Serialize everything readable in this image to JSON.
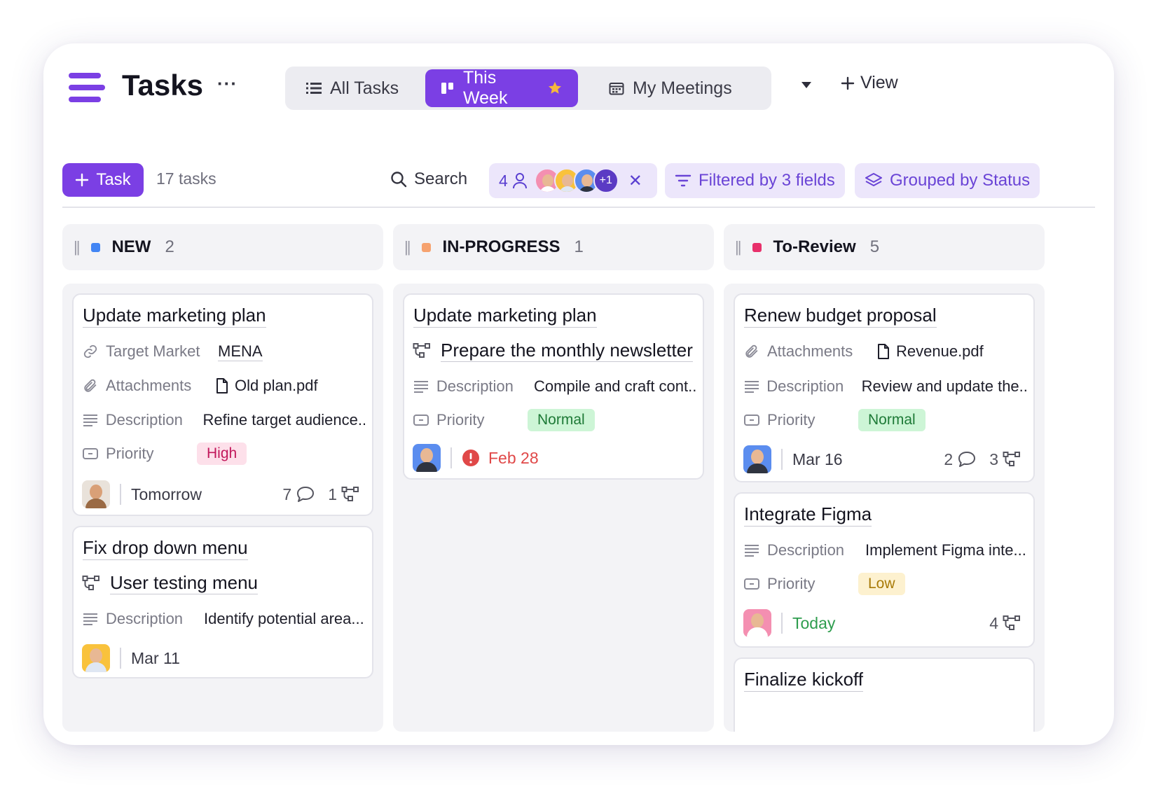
{
  "header": {
    "title": "Tasks",
    "more_label": "···",
    "views": [
      {
        "label": "All Tasks",
        "icon": "list-icon"
      },
      {
        "label": "This Week",
        "icon": "board-icon",
        "starred": true
      },
      {
        "label": "My Meetings",
        "icon": "calendar-icon"
      }
    ],
    "add_view_label": "View"
  },
  "toolbar": {
    "add_task_label": "Task",
    "task_count": "17 tasks",
    "search_label": "Search",
    "people_count": "4",
    "people_extra": "+1",
    "filter_label": "Filtered by 3 fields",
    "group_label": "Grouped by Status"
  },
  "colors": {
    "accent": "#7b3fe4",
    "new": "#4285f4",
    "in_progress": "#f6a26f",
    "to_review": "#e8306b"
  },
  "columns": [
    {
      "name": "NEW",
      "count": "2",
      "cards": [
        {
          "title": "Update marketing plan",
          "fields": [
            {
              "icon": "link-icon",
              "label": "Target Market",
              "value": "MENA"
            },
            {
              "icon": "paperclip-icon",
              "label": "Attachments",
              "value": "Old plan.pdf"
            },
            {
              "icon": "description-icon",
              "label": "Description",
              "value": "Refine target audience.."
            },
            {
              "icon": "priority-icon",
              "label": "Priority",
              "value": "High"
            }
          ],
          "footer": {
            "date": "Tomorrow",
            "comments": "7",
            "subtasks": "1"
          }
        },
        {
          "title": "Fix drop down menu",
          "subtask": "User testing menu",
          "fields": [
            {
              "icon": "description-icon",
              "label": "Description",
              "value": "Identify potential area..."
            }
          ],
          "footer": {
            "date": "Mar 11"
          }
        }
      ]
    },
    {
      "name": "IN-PROGRESS",
      "count": "1",
      "cards": [
        {
          "title": "Update marketing plan",
          "subtask": "Prepare the monthly newsletter",
          "fields": [
            {
              "icon": "description-icon",
              "label": "Description",
              "value": "Compile and craft cont.."
            },
            {
              "icon": "priority-icon",
              "label": "Priority",
              "value": "Normal"
            }
          ],
          "footer": {
            "date": "Feb 28",
            "overdue": true
          }
        }
      ]
    },
    {
      "name": "To-Review",
      "count": "5",
      "cards": [
        {
          "title": "Renew budget proposal",
          "fields": [
            {
              "icon": "paperclip-icon",
              "label": "Attachments",
              "value": "Revenue.pdf"
            },
            {
              "icon": "description-icon",
              "label": "Description",
              "value": "Review and update the..."
            },
            {
              "icon": "priority-icon",
              "label": "Priority",
              "value": "Normal"
            }
          ],
          "footer": {
            "date": "Mar 16",
            "comments": "2",
            "subtasks": "3"
          }
        },
        {
          "title": "Integrate Figma",
          "fields": [
            {
              "icon": "description-icon",
              "label": "Description",
              "value": "Implement Figma inte..."
            },
            {
              "icon": "priority-icon",
              "label": "Priority",
              "value": "Low"
            }
          ],
          "footer": {
            "date": "Today",
            "subtasks": "4"
          }
        },
        {
          "title": "Finalize kickoff"
        }
      ]
    }
  ]
}
